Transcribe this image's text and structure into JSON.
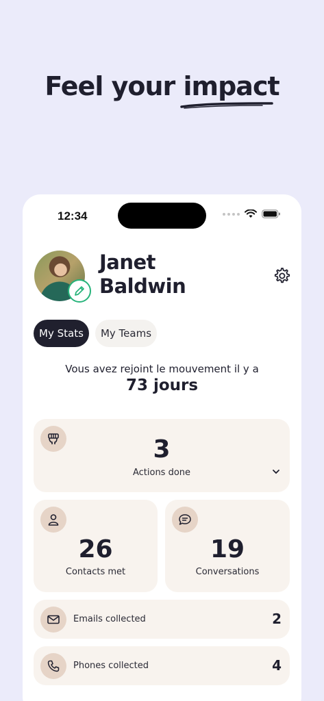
{
  "headline": {
    "part1": "Feel your",
    "part2": "impact"
  },
  "status_bar": {
    "time": "12:34"
  },
  "profile": {
    "first_name": "Janet",
    "last_name": "Baldwin"
  },
  "tabs": [
    {
      "label": "My Stats",
      "active": true
    },
    {
      "label": "My Teams",
      "active": false
    }
  ],
  "joined": {
    "text": "Vous avez rejoint le mouvement il y a",
    "days": "73 jours"
  },
  "stats": {
    "actions": {
      "value": "3",
      "label": "Actions done",
      "icon": "fist-icon"
    },
    "contacts": {
      "value": "26",
      "label": "Contacts met",
      "icon": "person-icon"
    },
    "conversations": {
      "value": "19",
      "label": "Conversations",
      "icon": "chat-bubble-icon"
    },
    "emails": {
      "value": "2",
      "label": "Emails collected",
      "icon": "envelope-icon"
    },
    "phones": {
      "value": "4",
      "label": "Phones collected",
      "icon": "phone-icon"
    }
  },
  "colors": {
    "background": "#ebebfa",
    "card": "#f8f3ee",
    "icon_circle": "#e6d4c7",
    "accent_green": "#26b37a",
    "dark": "#20202e"
  }
}
